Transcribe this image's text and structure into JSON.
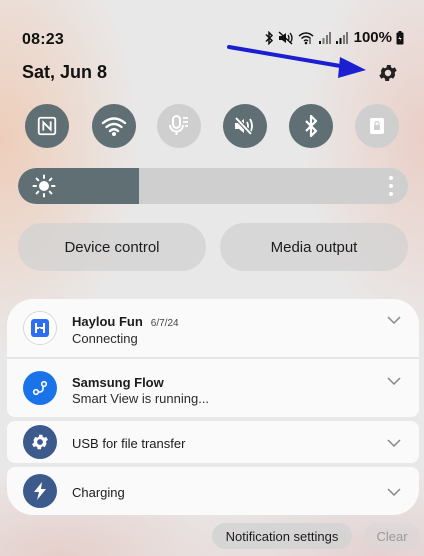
{
  "status_bar": {
    "time": "08:23",
    "battery": "100%",
    "icons": [
      "bluetooth-icon",
      "mute-icon",
      "wifi-icon",
      "signal-icon",
      "signal-icon",
      "battery-icon"
    ]
  },
  "header": {
    "date": "Sat, Jun 8",
    "settings_icon": "gear-icon"
  },
  "quick_settings": [
    {
      "name": "nfc",
      "icon": "nfc-icon",
      "active": true
    },
    {
      "name": "wifi",
      "icon": "wifi-icon",
      "active": true
    },
    {
      "name": "voice",
      "icon": "mic-icon",
      "active": false
    },
    {
      "name": "sound",
      "icon": "mute-icon",
      "active": true
    },
    {
      "name": "bluetooth",
      "icon": "bluetooth-icon",
      "active": true
    },
    {
      "name": "lock",
      "icon": "lock-icon",
      "active": false
    }
  ],
  "brightness": {
    "level": 0.31
  },
  "buttons": {
    "device_control": "Device control",
    "media_output": "Media output"
  },
  "notifications": [
    {
      "app": "Haylou Fun",
      "time": "6/7/24",
      "text": "Connecting",
      "icon": "haylou-icon",
      "icon_color": "#ffffff"
    },
    {
      "app": "Samsung Flow",
      "time": "",
      "text": "Smart View is running...",
      "icon": "flow-icon",
      "icon_color": "#1a73e8"
    },
    {
      "app": "USB for file transfer",
      "time": "",
      "text": "",
      "icon": "usb-gear-icon",
      "icon_color": "#3c5a8c"
    },
    {
      "app": "Charging",
      "time": "",
      "text": "",
      "icon": "lightning-icon",
      "icon_color": "#3c5a8c"
    }
  ],
  "footer": {
    "notification_settings": "Notification settings",
    "clear": "Clear"
  },
  "colors": {
    "tile_active": "#5f6f73",
    "tile_inactive": "#cfcfcf",
    "annotation_arrow": "#1a1fd1"
  }
}
